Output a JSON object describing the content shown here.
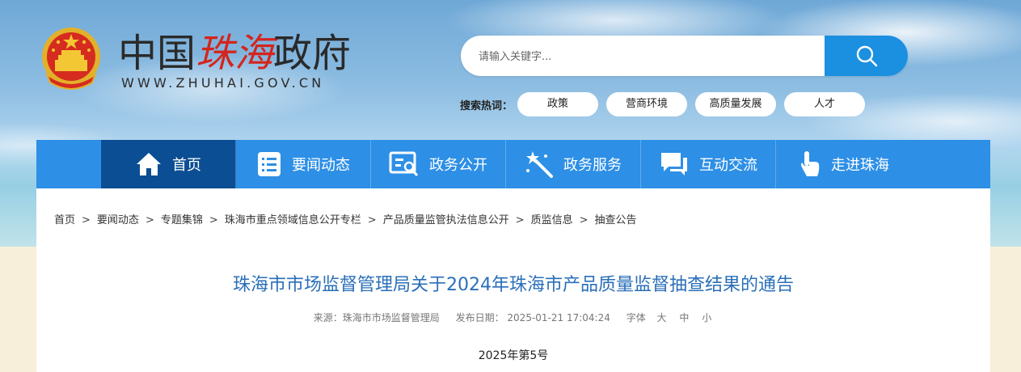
{
  "header": {
    "logo": {
      "prefix": "中国",
      "highlight": "珠海",
      "suffix": "政府",
      "url": "WWW.ZHUHAI.GOV.CN"
    },
    "search": {
      "placeholder": "请输入关键字..."
    },
    "hot": {
      "label": "搜索热词：",
      "tags": [
        "政策",
        "营商环境",
        "高质量发展",
        "人才"
      ]
    }
  },
  "nav": {
    "items": [
      {
        "label": "首页",
        "icon": "home-icon",
        "active": true
      },
      {
        "label": "要闻动态",
        "icon": "list-icon"
      },
      {
        "label": "政务公开",
        "icon": "document-search-icon"
      },
      {
        "label": "政务服务",
        "icon": "magic-wand-icon"
      },
      {
        "label": "互动交流",
        "icon": "chat-icon"
      },
      {
        "label": "走进珠海",
        "icon": "pointer-hand-icon"
      }
    ]
  },
  "breadcrumb": [
    "首页",
    "要闻动态",
    "专题集锦",
    "珠海市重点领域信息公开专栏",
    "产品质量监管执法信息公开",
    "质监信息",
    "抽查公告"
  ],
  "article": {
    "title": "珠海市市场监督管理局关于2024年珠海市产品质量监督抽查结果的通告",
    "source": "来源：珠海市市场监督管理局",
    "date": "发布日期： 2025-01-21 17:04:24",
    "font_label": "字体",
    "font_sizes": [
      "大",
      "中",
      "小"
    ],
    "doc_number": "2025年第5号"
  },
  "colors": {
    "nav": "#2d8fe6",
    "nav_active": "#0b4e93",
    "title": "#2a6fb8",
    "search_button": "#1b8fe0",
    "logo_red": "#d4251d"
  }
}
